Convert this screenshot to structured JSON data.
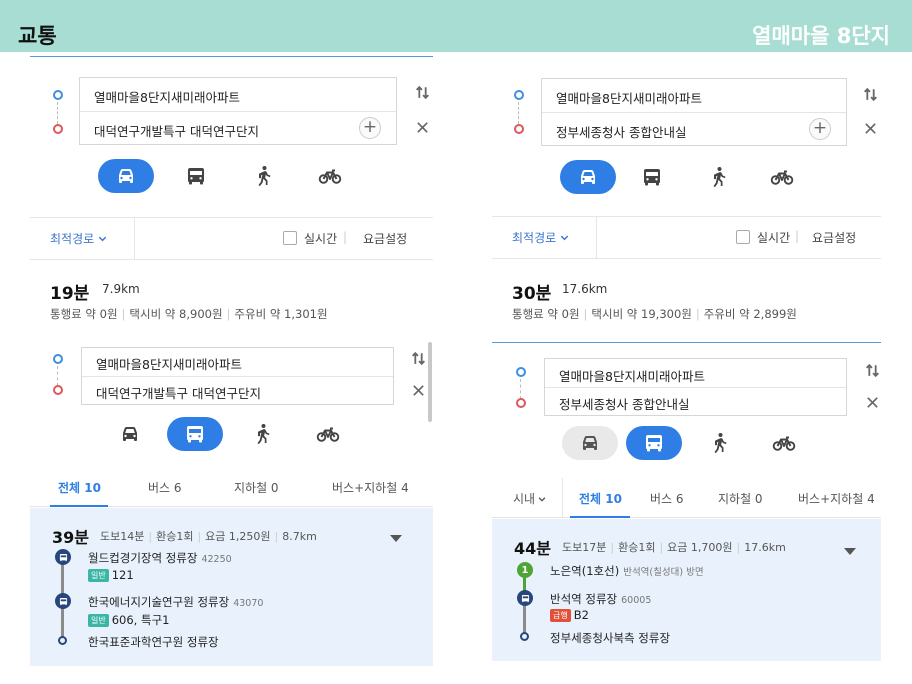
{
  "header": {
    "left_title": "교통",
    "right_title": "열매마을 8단지"
  },
  "icons": {
    "swap": "swap-arrows-icon",
    "close": "close-icon",
    "add": "plus-icon",
    "car": "car-icon",
    "bus": "bus-icon",
    "walk": "walk-icon",
    "bike": "bicycle-icon",
    "dropdown": "chevron-down-icon",
    "checkbox": "checkbox-icon",
    "bus_stop": "bus-stop-icon",
    "subway_line1": "subway-line-1-icon"
  },
  "colors": {
    "header_bg": "#a7ddd2",
    "active_mode": "#2f7ee6",
    "route_card_bg": "#e9f2fc",
    "origin_dot": "#3b8fe0",
    "dest_dot": "#e0575b",
    "line1_green": "#4ea435",
    "general_bus_tag": "#3bb5a6",
    "express_bus_tag": "#e0503a"
  },
  "left": {
    "car_search": {
      "origin": "열매마을8단지새미래아파트",
      "destination": "대덕연구개발특구 대덕연구단지",
      "active_mode": "car"
    },
    "options": {
      "sort": "최적경로",
      "realtime": "실시간",
      "fare_settings": "요금설정"
    },
    "car_summary": {
      "time": "19분",
      "distance": "7.9km",
      "fares": [
        "통행료 약 0원",
        "택시비 약 8,900원",
        "주유비 약 1,301원"
      ]
    },
    "transit_search": {
      "origin": "열매마을8단지새미래아파트",
      "destination": "대덕연구개발특구 대덕연구단지",
      "active_mode": "bus"
    },
    "tabs": [
      "전체 10",
      "버스 6",
      "지하철 0",
      "버스+지하철 4"
    ],
    "route": {
      "time": "39분",
      "meta": [
        "도보14분",
        "환승1회",
        "요금 1,250원",
        "8.7km"
      ],
      "steps": [
        {
          "name": "월드컵경기장역 정류장",
          "code": "42250",
          "tag": "일반",
          "bus": "121"
        },
        {
          "name": "한국에너지기술연구원 정류장",
          "code": "43070",
          "tag": "일반",
          "bus": "606, 특구1"
        },
        {
          "name": "한국표준과학연구원 정류장"
        }
      ]
    }
  },
  "right": {
    "car_search": {
      "origin": "열매마을8단지새미래아파트",
      "destination": "정부세종청사 종합안내실",
      "active_mode": "car"
    },
    "options": {
      "sort": "최적경로",
      "realtime": "실시간",
      "fare_settings": "요금설정"
    },
    "car_summary": {
      "time": "30분",
      "distance": "17.6km",
      "fares": [
        "통행료 약 0원",
        "택시비 약 19,300원",
        "주유비 약 2,899원"
      ]
    },
    "transit_search": {
      "origin": "열매마을8단지새미래아파트",
      "destination": "정부세종청사 종합안내실",
      "active_mode": "bus"
    },
    "region_filter": "시내",
    "tabs": [
      "전체 10",
      "버스 6",
      "지하철 0",
      "버스+지하철 4"
    ],
    "route": {
      "time": "44분",
      "meta": [
        "도보17분",
        "환승1회",
        "요금 1,700원",
        "17.6km"
      ],
      "steps": [
        {
          "name": "노은역(1호선)",
          "direction": "반석역(칠성대) 방면",
          "line_badge": "1"
        },
        {
          "name": "반석역 정류장",
          "code": "60005",
          "tag": "급행",
          "bus": "B2"
        },
        {
          "name": "정부세종청사북측 정류장"
        }
      ]
    }
  }
}
